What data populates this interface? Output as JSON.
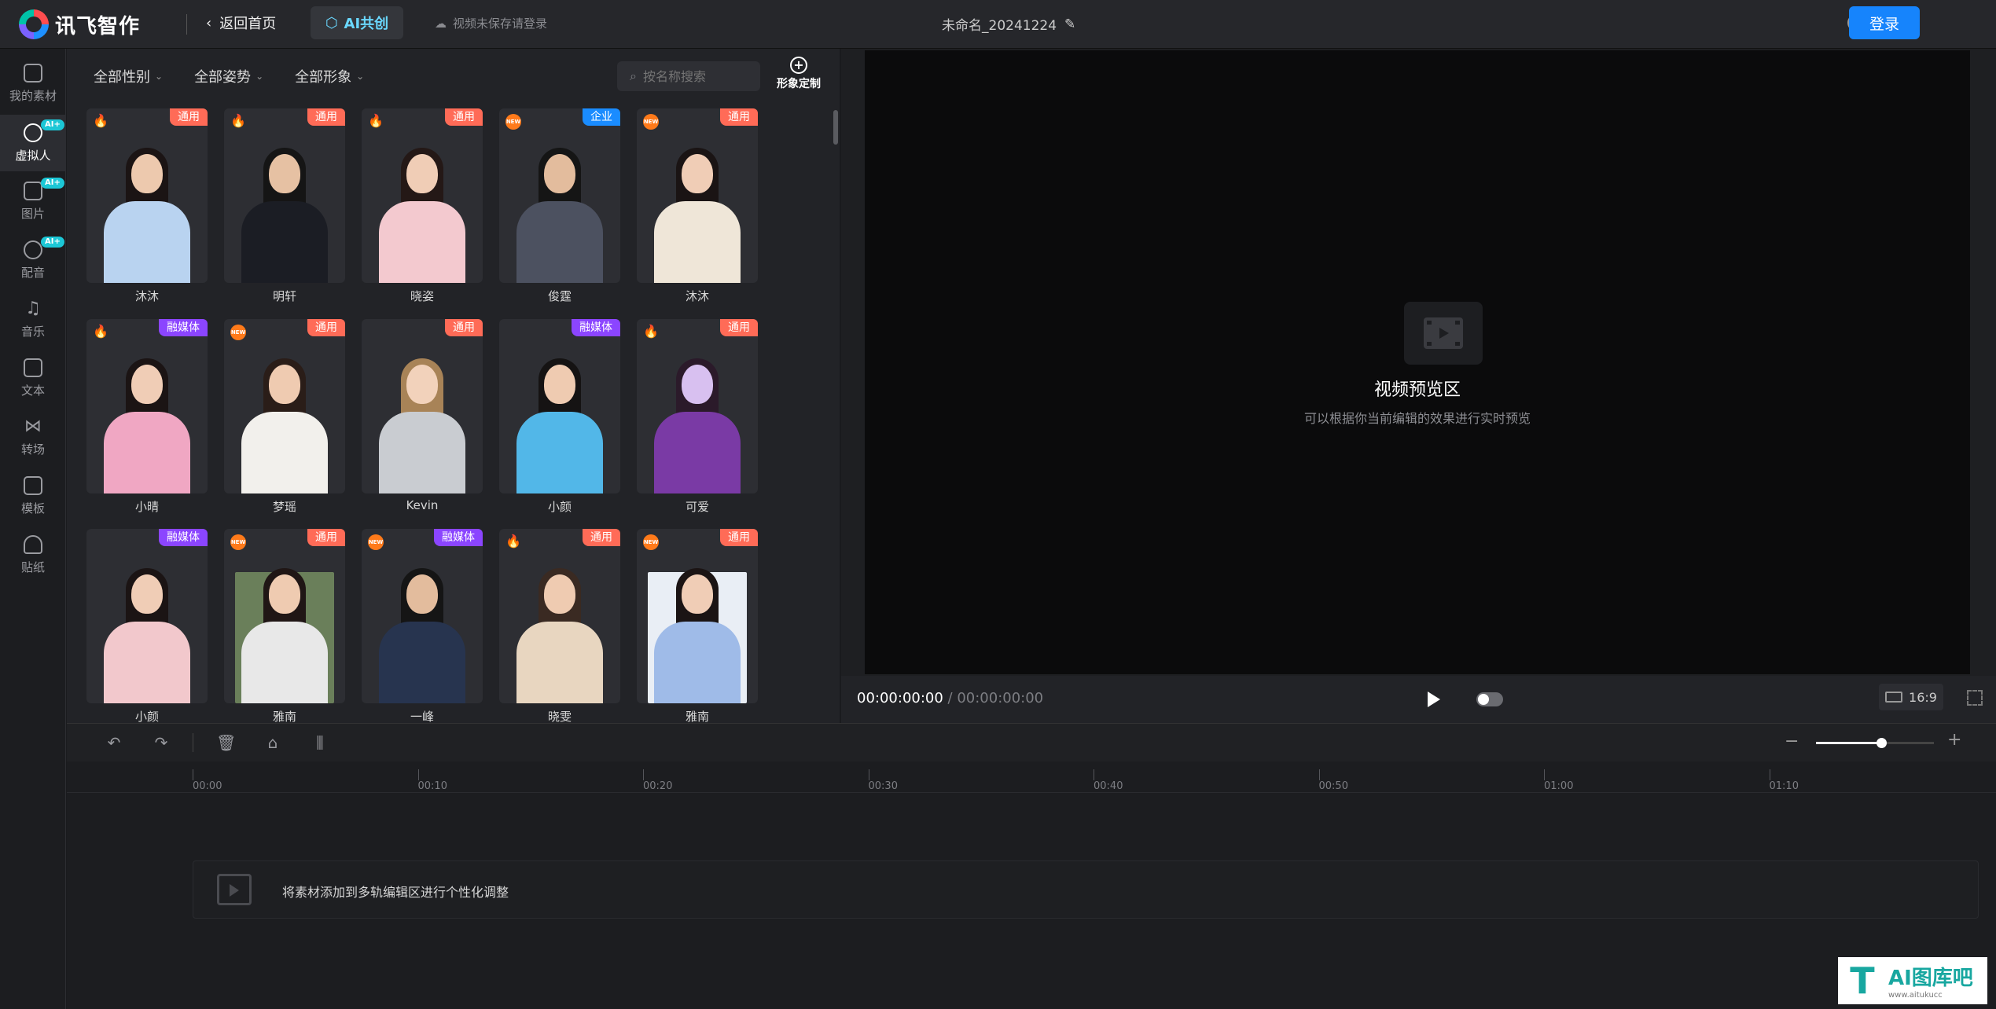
{
  "header": {
    "logo_text": "讯飞智作",
    "back_label": "返回首页",
    "ai_label": "AI共创",
    "save_hint": "视频未保存请登录",
    "doc_title": "未命名_20241224",
    "help_icon": "question-icon",
    "login_label": "登录"
  },
  "sidebar": {
    "items": [
      {
        "label": "我的素材",
        "icon": "play-square-icon"
      },
      {
        "label": "虚拟人",
        "icon": "avatar-icon",
        "badge": "AI+"
      },
      {
        "label": "图片",
        "icon": "image-icon",
        "badge": "AI+"
      },
      {
        "label": "配音",
        "icon": "voice-icon",
        "badge": "AI+"
      },
      {
        "label": "音乐",
        "icon": "music-icon"
      },
      {
        "label": "文本",
        "icon": "text-icon"
      },
      {
        "label": "转场",
        "icon": "transition-icon"
      },
      {
        "label": "模板",
        "icon": "template-icon"
      },
      {
        "label": "贴纸",
        "icon": "sticker-icon"
      }
    ]
  },
  "panel": {
    "filters": [
      "全部性别",
      "全部姿势",
      "全部形象"
    ],
    "search_placeholder": "按名称搜索",
    "custom_label": "形象定制",
    "avatars": [
      {
        "name": "沐沐",
        "tag": "通用",
        "mark": "hot"
      },
      {
        "name": "明轩",
        "tag": "通用",
        "mark": "hot"
      },
      {
        "name": "晓姿",
        "tag": "通用",
        "mark": "hot"
      },
      {
        "name": "俊霆",
        "tag": "企业",
        "mark": "new"
      },
      {
        "name": "沐沐",
        "tag": "通用",
        "mark": "new"
      },
      {
        "name": "小晴",
        "tag": "融媒体",
        "mark": "hot"
      },
      {
        "name": "梦瑶",
        "tag": "通用",
        "mark": "new"
      },
      {
        "name": "Kevin",
        "tag": "通用",
        "mark": ""
      },
      {
        "name": "小颜",
        "tag": "融媒体",
        "mark": ""
      },
      {
        "name": "可爱",
        "tag": "通用",
        "mark": "hot"
      },
      {
        "name": "小颜",
        "tag": "融媒体",
        "mark": ""
      },
      {
        "name": "雅南",
        "tag": "通用",
        "mark": "new"
      },
      {
        "name": "一峰",
        "tag": "融媒体",
        "mark": "new"
      },
      {
        "name": "晓雯",
        "tag": "通用",
        "mark": "hot"
      },
      {
        "name": "雅南",
        "tag": "通用",
        "mark": "new"
      }
    ]
  },
  "preview": {
    "title": "视频预览区",
    "subtitle": "可以根据你当前编辑的效果进行实时预览",
    "current_time": "00:00:00:00",
    "separator": " / ",
    "duration": "00:00:00:00",
    "ratio": "16:9"
  },
  "timeline": {
    "ticks": [
      "00:00",
      "00:10",
      "00:20",
      "00:30",
      "00:40",
      "00:50",
      "01:00",
      "01:10"
    ],
    "drop_hint": "将素材添加到多轨编辑区进行个性化调整",
    "zoom_level": 0.55
  },
  "watermark": {
    "title": "AI图库吧",
    "url": "www.aitukucc"
  },
  "colors": {
    "accent": "#1684fc",
    "tag_general": "#ff6b57",
    "tag_media": "#8b45ff",
    "tag_enterprise": "#1a8cff"
  }
}
